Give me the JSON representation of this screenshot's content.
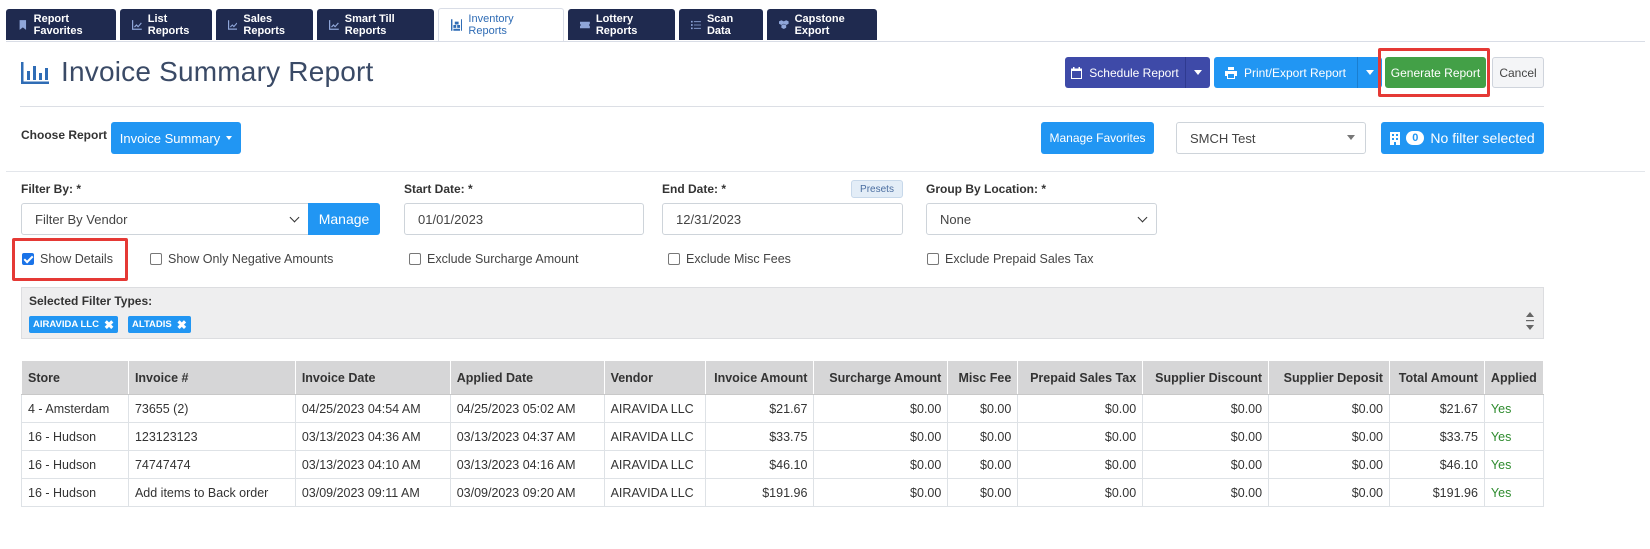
{
  "tabs": [
    {
      "label": "Report Favorites",
      "icon": "bookmark-icon"
    },
    {
      "label": "List Reports",
      "icon": "chart-line-icon"
    },
    {
      "label": "Sales Reports",
      "icon": "chart-line-icon"
    },
    {
      "label": "Smart Till Reports",
      "icon": "chart-line-icon"
    },
    {
      "label": "Inventory Reports",
      "icon": "warehouse-icon"
    },
    {
      "label": "Lottery Reports",
      "icon": "ticket-icon"
    },
    {
      "label": "Scan Data",
      "icon": "list-icon"
    },
    {
      "label": "Capstone Export",
      "icon": "cubes-icon"
    }
  ],
  "header": {
    "title": "Invoice Summary Report",
    "schedule_label": "Schedule Report",
    "print_label": "Print/Export Report",
    "generate_label": "Generate Report",
    "cancel_label": "Cancel"
  },
  "choose": {
    "label": "Choose Report",
    "report_label": "Invoice Summary",
    "manage_favorites_label": "Manage Favorites",
    "store_value": "SMCH Test",
    "filter_count": "0",
    "filter_label": "No filter selected"
  },
  "filters": {
    "filter_by_label": "Filter By: *",
    "filter_by_value": "Filter By Vendor",
    "manage_label": "Manage",
    "start_date_label": "Start Date: *",
    "start_date_value": "01/01/2023",
    "end_date_label": "End Date: *",
    "end_date_value": "12/31/2023",
    "presets_label": "Presets",
    "group_by_label": "Group By Location: *",
    "group_by_value": "None"
  },
  "options": [
    {
      "label": "Show Details",
      "checked": true
    },
    {
      "label": "Show Only Negative Amounts",
      "checked": false
    },
    {
      "label": "Exclude Surcharge Amount",
      "checked": false
    },
    {
      "label": "Exclude Misc Fees",
      "checked": false
    },
    {
      "label": "Exclude Prepaid Sales Tax",
      "checked": false
    }
  ],
  "selected_filters": {
    "label": "Selected Filter Types:",
    "chips": [
      "AIRAVIDA LLC",
      "ALTADIS"
    ]
  },
  "table": {
    "headers": [
      "Store",
      "Invoice #",
      "Invoice Date",
      "Applied Date",
      "Vendor",
      "Invoice Amount",
      "Surcharge Amount",
      "Misc Fee",
      "Prepaid Sales Tax",
      "Supplier Discount",
      "Supplier Deposit",
      "Total Amount",
      "Applied"
    ],
    "rows": [
      [
        "4 - Amsterdam",
        "73655 (2)",
        "04/25/2023 04:54 AM",
        "04/25/2023 05:02 AM",
        "AIRAVIDA LLC",
        "$21.67",
        "$0.00",
        "$0.00",
        "$0.00",
        "$0.00",
        "$0.00",
        "$21.67",
        "Yes"
      ],
      [
        "16 - Hudson",
        "123123123",
        "03/13/2023 04:36 AM",
        "03/13/2023 04:37 AM",
        "AIRAVIDA LLC",
        "$33.75",
        "$0.00",
        "$0.00",
        "$0.00",
        "$0.00",
        "$0.00",
        "$33.75",
        "Yes"
      ],
      [
        "16 - Hudson",
        "74747474",
        "03/13/2023 04:10 AM",
        "03/13/2023 04:16 AM",
        "AIRAVIDA LLC",
        "$46.10",
        "$0.00",
        "$0.00",
        "$0.00",
        "$0.00",
        "$0.00",
        "$46.10",
        "Yes"
      ],
      [
        "16 - Hudson",
        "Add items to Back order",
        "03/09/2023 09:11 AM",
        "03/09/2023 09:20 AM",
        "AIRAVIDA LLC",
        "$191.96",
        "$0.00",
        "$0.00",
        "$0.00",
        "$0.00",
        "$0.00",
        "$191.96",
        "Yes"
      ]
    ]
  },
  "colors": {
    "tab_bg": "#1f2a4f",
    "primary": "#2196f3",
    "schedule": "#3e4aa8",
    "generate": "#43a047",
    "highlight": "#e53935"
  }
}
